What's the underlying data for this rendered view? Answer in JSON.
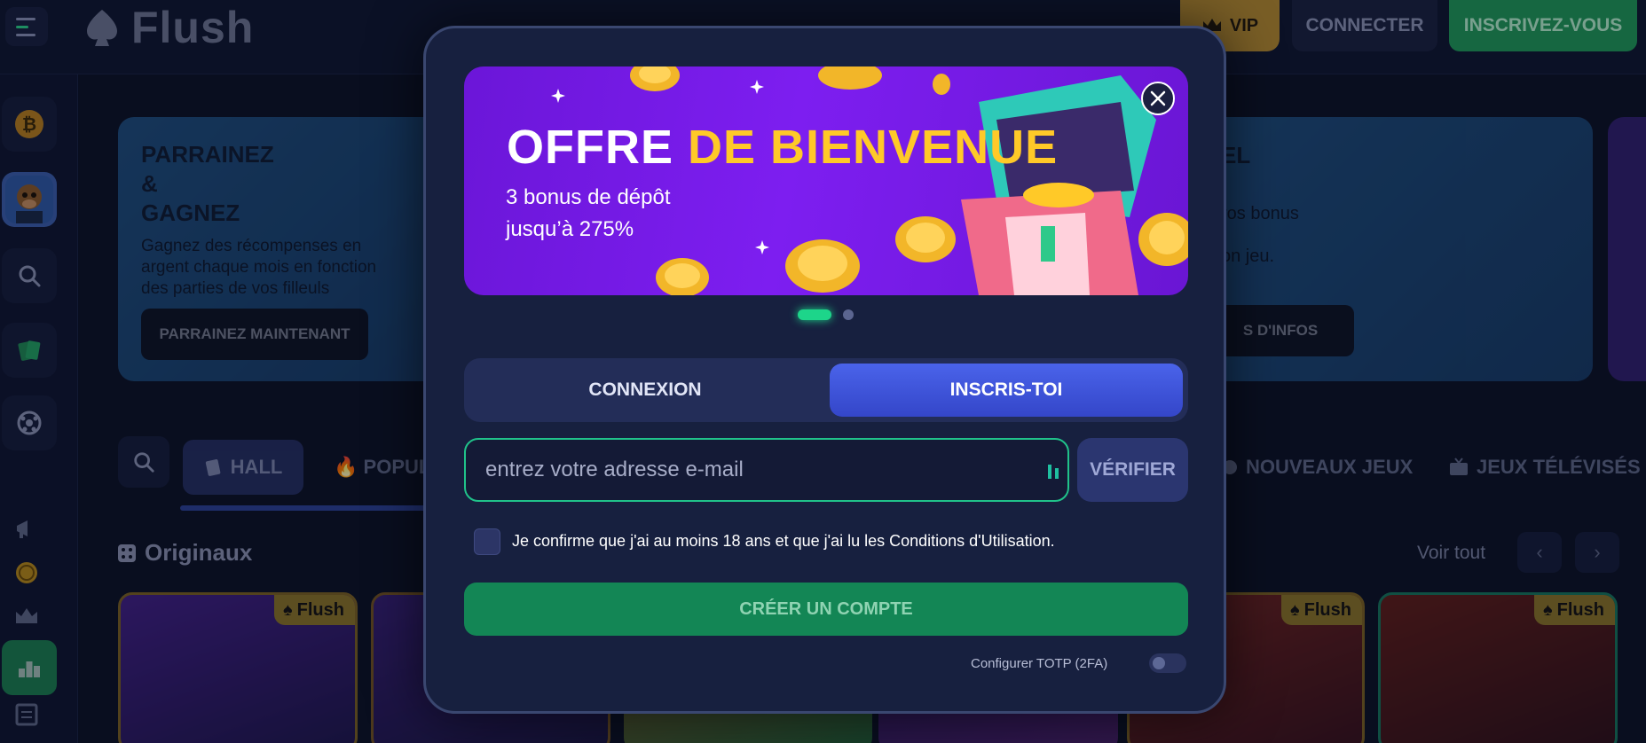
{
  "header": {
    "logo_text": "Flush",
    "vip_label": "VIP",
    "connect_label": "CONNECTER",
    "signup_label": "INSCRIVEZ-VOUS"
  },
  "promos": {
    "left": {
      "title_line1": "PARRAINEZ",
      "title_line2": "&",
      "title_line3": "GAGNEZ",
      "text": "Gagnez des récompenses en argent chaque mois en fonction des parties de vos filleuls",
      "button": "PARRAINEZ MAINTENANT"
    },
    "right": {
      "title_fragment": "EL",
      "text1": "ros bonus",
      "text2": "on jeu.",
      "button": "S D'INFOS"
    }
  },
  "categories": {
    "hall": "HALL",
    "popul": "POPUL",
    "nouveaux": "NOUVEAUX JEUX",
    "jeux_televises": "JEUX TÉLÉVISÉS"
  },
  "section": {
    "title": "Originaux",
    "see_all": "Voir tout",
    "tile_badge": "Flush"
  },
  "modal": {
    "banner": {
      "title_part1": "OFFRE",
      "title_part2": "DE BIENVENUE",
      "subtitle1": "3 bonus de dépôt",
      "subtitle2": "jusqu’à 275%"
    },
    "tabs": {
      "login": "CONNEXION",
      "register": "INSCRIS-TOI"
    },
    "email_placeholder": "entrez votre adresse e-mail",
    "verify_label": "VÉRIFIER",
    "consent_text": "Je confirme que j'ai au moins 18 ans et que j'ai lu les Conditions d'Utilisation.",
    "create_label": "CRÉER UN COMPTE",
    "totp_label": "Configurer TOTP (2FA)"
  },
  "colors": {
    "accent_green": "#1dd58a",
    "accent_blue": "#4a63ea",
    "banner_purple": "#7d1ef0",
    "highlight_yellow": "#ffc928"
  }
}
